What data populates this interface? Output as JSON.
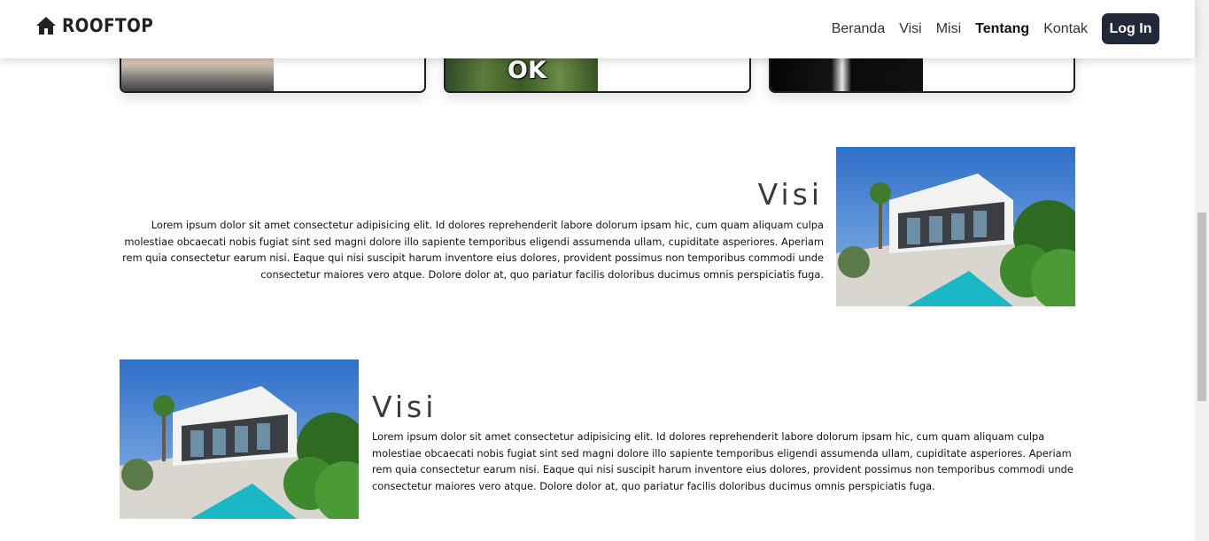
{
  "brand": {
    "name": "ROOFTOP",
    "icon": "house-icon"
  },
  "nav": {
    "links": [
      "Beranda",
      "Visi",
      "Misi",
      "Tentang",
      "Kontak"
    ],
    "active": "Tentang",
    "login_label": "Log In"
  },
  "cards": [
    {
      "image": "dog-photo"
    },
    {
      "image": "ok-meme",
      "overlay_text": "OK"
    },
    {
      "image": "suit-photo"
    }
  ],
  "sections": [
    {
      "title": "Visi",
      "text": "Lorem ipsum dolor sit amet consectetur adipisicing elit. Id dolores reprehenderit labore dolorum ipsam hic, cum quam aliquam culpa molestiae obcaecati nobis fugiat sint sed magni dolore illo sapiente temporibus eligendi assumenda ullam, cupiditate asperiores. Aperiam rem quia consectetur earum nisi. Eaque qui nisi suscipit harum inventore eius dolores, provident possimus non temporibus commodi unde consectetur maiores vero atque. Dolore dolor at, quo pariatur facilis doloribus ducimus omnis perspiciatis fuga.",
      "image": "modern-house-photo",
      "align": "right"
    },
    {
      "title": "Visi",
      "text": "Lorem ipsum dolor sit amet consectetur adipisicing elit. Id dolores reprehenderit labore dolorum ipsam hic, cum quam aliquam culpa molestiae obcaecati nobis fugiat sint sed magni dolore illo sapiente temporibus eligendi assumenda ullam, cupiditate asperiores. Aperiam rem quia consectetur earum nisi. Eaque qui nisi suscipit harum inventore eius dolores, provident possimus non temporibus commodi unde consectetur maiores vero atque. Dolore dolor at, quo pariatur facilis doloribus ducimus omnis perspiciatis fuga.",
      "image": "modern-house-photo",
      "align": "left"
    }
  ],
  "colors": {
    "navbar_bg": "#ffffff",
    "button_bg": "#212838",
    "title_color": "#3c3a38"
  }
}
